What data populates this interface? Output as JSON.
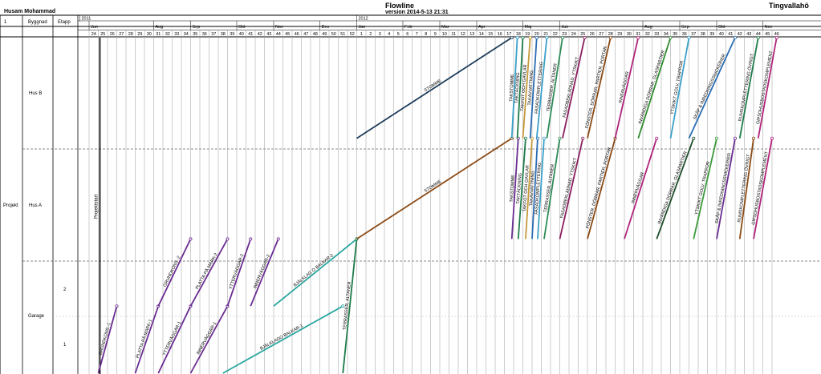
{
  "header": {
    "author": "Husam Mohammad",
    "title": "Flowline",
    "version": "version 2014-5-13 21:31",
    "project_name": "Tingvallahö"
  },
  "left_columns": {
    "col1": "1",
    "col2": "Byggnad",
    "col3": "Etapp"
  },
  "rows": {
    "project": "Projekt",
    "hus_b": "Hus B",
    "hus_a": "Hus A",
    "garage": "Garage",
    "garage_2": "2",
    "garage_1": "1"
  },
  "colors": {
    "grid": "#9a9a9a",
    "dashed": "#666666"
  },
  "chart_data": {
    "type": "line",
    "title": "Flowline",
    "years": [
      {
        "label": "2011",
        "week": 24
      },
      {
        "label": "2012",
        "week": 53
      }
    ],
    "months": [
      {
        "label": "Jun",
        "week": 24
      },
      {
        "label": "Aug",
        "week": 31
      },
      {
        "label": "Sep",
        "week": 35
      },
      {
        "label": "Okt",
        "week": 40
      },
      {
        "label": "Nov",
        "week": 44
      },
      {
        "label": "Dec",
        "week": 49
      },
      {
        "label": "Jan",
        "week": 53
      },
      {
        "label": "Feb",
        "week": 58
      },
      {
        "label": "Mar",
        "week": 62
      },
      {
        "label": "Apr",
        "week": 66
      },
      {
        "label": "Maj",
        "week": 71
      },
      {
        "label": "Jun",
        "week": 75
      },
      {
        "label": "Aug",
        "week": 84
      },
      {
        "label": "Sep",
        "week": 88
      },
      {
        "label": "Okt",
        "week": 92
      },
      {
        "label": "Nov",
        "week": 97
      }
    ],
    "week_ticks": [
      "24",
      "25",
      "26",
      "27",
      "28",
      "29",
      "30",
      "31",
      "32",
      "33",
      "34",
      "35",
      "36",
      "37",
      "38",
      "39",
      "40",
      "41",
      "42",
      "43",
      "44",
      "45",
      "46",
      "47",
      "48",
      "49",
      "50",
      "51",
      "52",
      "1",
      "2",
      "3",
      "4",
      "5",
      "6",
      "7",
      "8",
      "9",
      "10",
      "11",
      "12",
      "13",
      "14",
      "15",
      "16",
      "17",
      "18",
      "19",
      "20",
      "21",
      "22",
      "23",
      "24",
      "25",
      "26",
      "27",
      "28",
      "29",
      "30",
      "31",
      "32",
      "33",
      "34",
      "35",
      "36",
      "37",
      "38",
      "39",
      "40",
      "41",
      "42",
      "43",
      "44",
      "45",
      "46"
    ],
    "x_axis": {
      "unit": "week",
      "range": [
        24,
        99
      ]
    },
    "y_axis": {
      "unit": "location",
      "range": [
        0,
        1
      ]
    },
    "milestones": [
      {
        "label": "Projektstart",
        "week": 25
      }
    ],
    "series": [
      {
        "name": "GRUNDKONS.-1",
        "color": "#6a2c91",
        "x": [
          25,
          27
        ],
        "y": [
          0,
          0.2
        ]
      },
      {
        "name": "PLATTA PÅ MARK-1",
        "color": "#6a2c91",
        "x": [
          29,
          31.5
        ],
        "y": [
          0,
          0.2
        ]
      },
      {
        "name": "GRUNDKONS.-2",
        "color": "#6a2c91",
        "x": [
          31.5,
          35
        ],
        "y": [
          0.2,
          0.4
        ]
      },
      {
        "name": "YTTERVÄGGAR-1",
        "color": "#6a2c91",
        "x": [
          31.5,
          35
        ],
        "y": [
          0,
          0.2
        ]
      },
      {
        "name": "PLATTA PÅ MARK-2",
        "color": "#6a2c91",
        "x": [
          35,
          39
        ],
        "y": [
          0.2,
          0.4
        ]
      },
      {
        "name": "INNERVÄGGAR-1",
        "color": "#6a2c91",
        "x": [
          35,
          39
        ],
        "y": [
          0,
          0.2
        ]
      },
      {
        "name": "YTTERVÄGGAR-2",
        "color": "#6a2c91",
        "x": [
          39,
          41.5
        ],
        "y": [
          0.2,
          0.4
        ]
      },
      {
        "name": "INNERVÄGGAR-2",
        "color": "#6a2c91",
        "x": [
          41.5,
          44.5
        ],
        "y": [
          0.2,
          0.4
        ]
      },
      {
        "name": "BJÄLKLAGO BALKAR-1",
        "color": "#2aa6a0",
        "x": [
          38.5,
          51.5
        ],
        "y": [
          0,
          0.2
        ]
      },
      {
        "name": "BJÄLKLAG O BALKAR-2",
        "color": "#2aa6a0",
        "x": [
          44,
          53
        ],
        "y": [
          0.2,
          0.4
        ]
      },
      {
        "name": "TERRASSER, ALTANER",
        "color": "#1e7b4a",
        "x": [
          51.5,
          53
        ],
        "y": [
          0,
          0.4
        ]
      },
      {
        "name": "STOMME",
        "color": "#8b4a14",
        "x": [
          53,
          69.8
        ],
        "y": [
          0.4,
          0.7
        ]
      },
      {
        "name": "STOMME",
        "color": "#1e3d5a",
        "x": [
          53,
          69.8
        ],
        "y": [
          0.7,
          1.0
        ]
      },
      {
        "name": "TAKSTOMME",
        "color": "#6a2c91",
        "x": [
          69.8,
          70.5
        ],
        "y": [
          0.4,
          0.7
        ]
      },
      {
        "name": "TAKTÄCKNING",
        "color": "#1e7b4a",
        "x": [
          70.5,
          71.3
        ],
        "y": [
          0.4,
          0.7
        ]
      },
      {
        "name": "TAKFOT OCH GAVLAR",
        "color": "#c49a3a",
        "x": [
          71.3,
          72
        ],
        "y": [
          0.4,
          0.7
        ]
      },
      {
        "name": "TAKAVVATTNING",
        "color": "#2b6cb3",
        "x": [
          72,
          72.6
        ],
        "y": [
          0.4,
          0.7
        ]
      },
      {
        "name": "FASADKOMPLETTERING",
        "color": "#3aa0c9",
        "x": [
          72.6,
          73.3
        ],
        "y": [
          0.4,
          0.7
        ]
      },
      {
        "name": "TERRASSER, ALTANER",
        "color": "#2e8b57",
        "x": [
          73.3,
          75
        ],
        "y": [
          0.4,
          0.7
        ]
      },
      {
        "name": "FASADBEKLÄDNAD, YTSKIKT",
        "color": "#8a1d5e",
        "x": [
          75,
          77.5
        ],
        "y": [
          0.4,
          0.7
        ]
      },
      {
        "name": "FÖNSTER, DÖRRAR, PARTIER, PORTAR",
        "color": "#8b4a14",
        "x": [
          78,
          81
        ],
        "y": [
          0.4,
          0.7
        ]
      },
      {
        "name": "INNERVÄGGAR",
        "color": "#b0237a",
        "x": [
          82,
          85.5
        ],
        "y": [
          0.4,
          0.7
        ]
      },
      {
        "name": "INVÄNDIGA DÖRRAR, GLASPARTIER",
        "color": "#1e4d2b",
        "x": [
          85.5,
          89.5
        ],
        "y": [
          0.4,
          0.7
        ]
      },
      {
        "name": "YTSKIKT GOLV, TRAPPOR",
        "color": "#3b9a3b",
        "x": [
          89.5,
          92
        ],
        "y": [
          0.4,
          0.7
        ]
      },
      {
        "name": "SKÅP & INREDNINGSSNICKERIER",
        "color": "#6a2c91",
        "x": [
          92,
          94
        ],
        "y": [
          0.4,
          0.7
        ]
      },
      {
        "name": "RUMSKOMPLETTERING ÖVRIGT",
        "color": "#8b4a14",
        "x": [
          94.5,
          96
        ],
        "y": [
          0.4,
          0.7
        ]
      },
      {
        "name": "GIPSDHUSBOSTADSKOMPLEMENT",
        "color": "#b0237a",
        "x": [
          96,
          98
        ],
        "y": [
          0.4,
          0.7
        ]
      },
      {
        "name": "TAKSTOMME",
        "color": "#3aa0c9",
        "x": [
          69.8,
          70.4
        ],
        "y": [
          0.7,
          1.0
        ]
      },
      {
        "name": "TAKTÄCKNING",
        "color": "#1e7b4a",
        "x": [
          70.4,
          71
        ],
        "y": [
          0.7,
          1.0
        ]
      },
      {
        "name": "TAKFOT OCH GAVLAR",
        "color": "#c49a3a",
        "x": [
          71,
          71.8
        ],
        "y": [
          0.7,
          1.0
        ]
      },
      {
        "name": "TAKAVVATTNING",
        "color": "#2b6cb3",
        "x": [
          71.8,
          72.5
        ],
        "y": [
          0.7,
          1.0
        ]
      },
      {
        "name": "FASADKOMPLETTERING",
        "color": "#3aa0c9",
        "x": [
          72.5,
          73.6
        ],
        "y": [
          0.7,
          1.0
        ]
      },
      {
        "name": "TERRASSER, ALTANER",
        "color": "#2e8b57",
        "x": [
          73.6,
          75.3
        ],
        "y": [
          0.7,
          1.0
        ]
      },
      {
        "name": "FASADBEKLÄDNAD, YTSKIKT",
        "color": "#8a1d5e",
        "x": [
          75.3,
          77.7
        ],
        "y": [
          0.7,
          1.0
        ]
      },
      {
        "name": "FÖNSTER, DÖRRAR, PARTIER, PORTAR",
        "color": "#8b4a14",
        "x": [
          78,
          80.5
        ],
        "y": [
          0.7,
          1.0
        ]
      },
      {
        "name": "INNERVÄGGAR",
        "color": "#b0237a",
        "x": [
          81,
          83.5
        ],
        "y": [
          0.7,
          1.0
        ]
      },
      {
        "name": "INVÄNDIGA DÖRRAR, GLASPARTIER",
        "color": "#2e8b2e",
        "x": [
          83.5,
          87
        ],
        "y": [
          0.7,
          1.0
        ]
      },
      {
        "name": "YTSKIKT GOLV, TRAPPOR",
        "color": "#3aa0c9",
        "x": [
          87,
          89
        ],
        "y": [
          0.7,
          1.0
        ]
      },
      {
        "name": "SKÅP & INREDNINGSSNICKERIER",
        "color": "#2b6cb3",
        "x": [
          89,
          94
        ],
        "y": [
          0.7,
          1.0
        ]
      },
      {
        "name": "RUMSKOMPLETTERING ÖVRIGT",
        "color": "#1e7b4a",
        "x": [
          94.5,
          96.5
        ],
        "y": [
          0.7,
          1.0
        ]
      },
      {
        "name": "GIPSDHUSBOSTADSKOMPLEMENT",
        "color": "#b0237a",
        "x": [
          96.5,
          98.5
        ],
        "y": [
          0.7,
          1.0
        ]
      }
    ]
  }
}
